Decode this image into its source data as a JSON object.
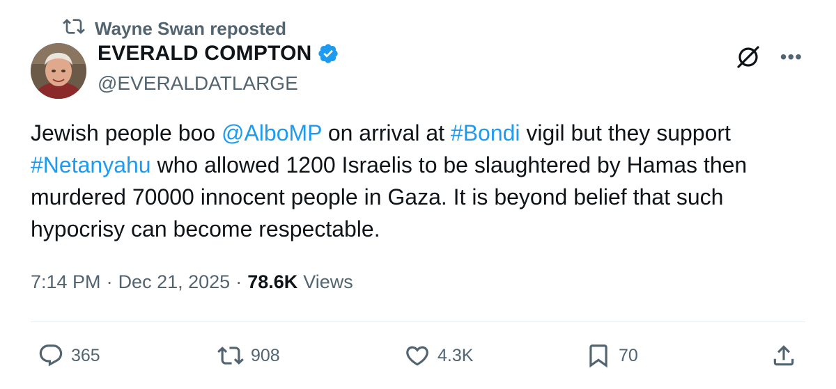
{
  "repost": {
    "label": "Wayne Swan reposted"
  },
  "author": {
    "name": "EVERALD COMPTON",
    "handle": "@EVERALDATLARGE",
    "verified": true
  },
  "tweet": {
    "segments": [
      {
        "text": "Jewish people boo ",
        "link": false
      },
      {
        "text": "@AlboMP",
        "link": true
      },
      {
        "text": " on arrival at ",
        "link": false
      },
      {
        "text": "#Bondi",
        "link": true
      },
      {
        "text": " vigil but they support ",
        "link": false
      },
      {
        "text": "#Netanyahu",
        "link": true
      },
      {
        "text": " who allowed 1200 Israelis to be slaughtered by Hamas then murdered 70000 innocent people in Gaza. It is beyond belief that such hypocrisy can become respectable.",
        "link": false
      }
    ]
  },
  "meta": {
    "time": "7:14 PM",
    "sep1": "·",
    "date": "Dec 21, 2025",
    "sep2": "·",
    "views_count": "78.6K",
    "views_label": "Views"
  },
  "actions": {
    "replies": "365",
    "reposts": "908",
    "likes": "4.3K",
    "bookmarks": "70"
  },
  "icons": {
    "repost": "repost-icon",
    "verified": "verified-badge-icon",
    "grok": "grok-icon",
    "more": "more-icon",
    "reply": "reply-icon",
    "like": "heart-icon",
    "bookmark": "bookmark-icon",
    "share": "share-icon"
  },
  "colors": {
    "link": "#1d9bf0",
    "secondary": "#536471",
    "text": "#0f1419"
  }
}
